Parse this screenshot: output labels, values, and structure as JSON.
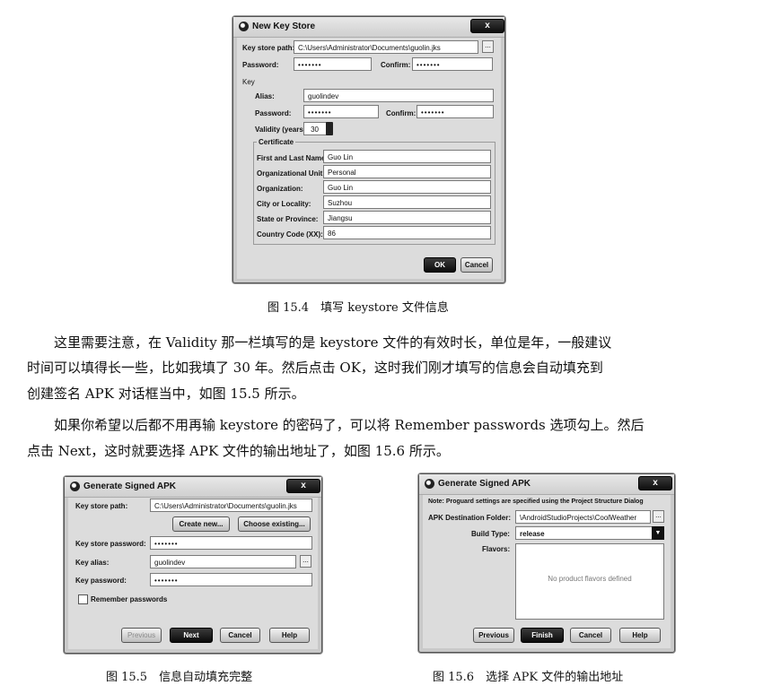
{
  "fig154": {
    "title": "New Key Store",
    "close": "x",
    "key_store_path_label": "Key store path:",
    "key_store_path_value": "C:\\Users\\Administrator\\Documents\\guolin.jks",
    "browse": "...",
    "password_label": "Password:",
    "password_value": "•••••••",
    "confirm_label": "Confirm:",
    "confirm_value": "•••••••",
    "key_section": "Key",
    "alias_label": "Alias:",
    "alias_value": "guolindev",
    "key_password_label": "Password:",
    "key_password_value": "•••••••",
    "key_confirm_label": "Confirm:",
    "key_confirm_value": "•••••••",
    "validity_label": "Validity (years):",
    "validity_value": "30",
    "certificate_title": "Certificate",
    "first_last_label": "First and Last Name:",
    "first_last_value": "Guo Lin",
    "org_unit_label": "Organizational Unit:",
    "org_unit_value": "Personal",
    "org_label": "Organization:",
    "org_value": "Guo Lin",
    "city_label": "City or Locality:",
    "city_value": "Suzhou",
    "state_label": "State or Province:",
    "state_value": "Jiangsu",
    "country_label": "Country Code (XX):",
    "country_value": "86",
    "ok": "OK",
    "cancel": "Cancel"
  },
  "caption154": "图 15.4　填写 keystore 文件信息",
  "paragraph1": {
    "line1": "这里需要注意，在 Validity 那一栏填写的是 keystore 文件的有效时长，单位是年，一般建议",
    "line2": "时间可以填得长一些，比如我填了 30 年。然后点击 OK，这时我们刚才填写的信息会自动填充到",
    "line3": "创建签名 APK 对话框当中，如图 15.5 所示。"
  },
  "paragraph2": {
    "line1": "如果你希望以后都不用再输 keystore 的密码了，可以将 Remember passwords 选项勾上。然后",
    "line2": "点击 Next，这时就要选择 APK 文件的输出地址了，如图 15.6 所示。"
  },
  "fig155": {
    "title": "Generate Signed APK",
    "close": "x",
    "key_store_path_label": "Key store path:",
    "key_store_path_value": "C:\\Users\\Administrator\\Documents\\guolin.jks",
    "create_new": "Create new...",
    "choose_existing": "Choose existing...",
    "key_store_password_label": "Key store password:",
    "key_store_password_value": "•••••••",
    "key_alias_label": "Key alias:",
    "key_alias_value": "guolindev",
    "browse": "...",
    "key_password_label": "Key password:",
    "key_password_value": "•••••••",
    "remember_label": "Remember passwords",
    "previous": "Previous",
    "next": "Next",
    "cancel": "Cancel",
    "help": "Help"
  },
  "caption155": "图 15.5　信息自动填充完整",
  "fig156": {
    "title": "Generate Signed APK",
    "close": "x",
    "note": "Note: Proguard settings are specified using the Project Structure Dialog",
    "dest_label": "APK Destination Folder:",
    "dest_value": "\\AndroidStudioProjects\\CoolWeather",
    "browse": "...",
    "build_type_label": "Build Type:",
    "build_type_value": "release",
    "flavors_label": "Flavors:",
    "flavors_empty": "No product flavors defined",
    "previous": "Previous",
    "finish": "Finish",
    "cancel": "Cancel",
    "help": "Help"
  },
  "caption156": "图 15.6　选择 APK 文件的输出地址"
}
